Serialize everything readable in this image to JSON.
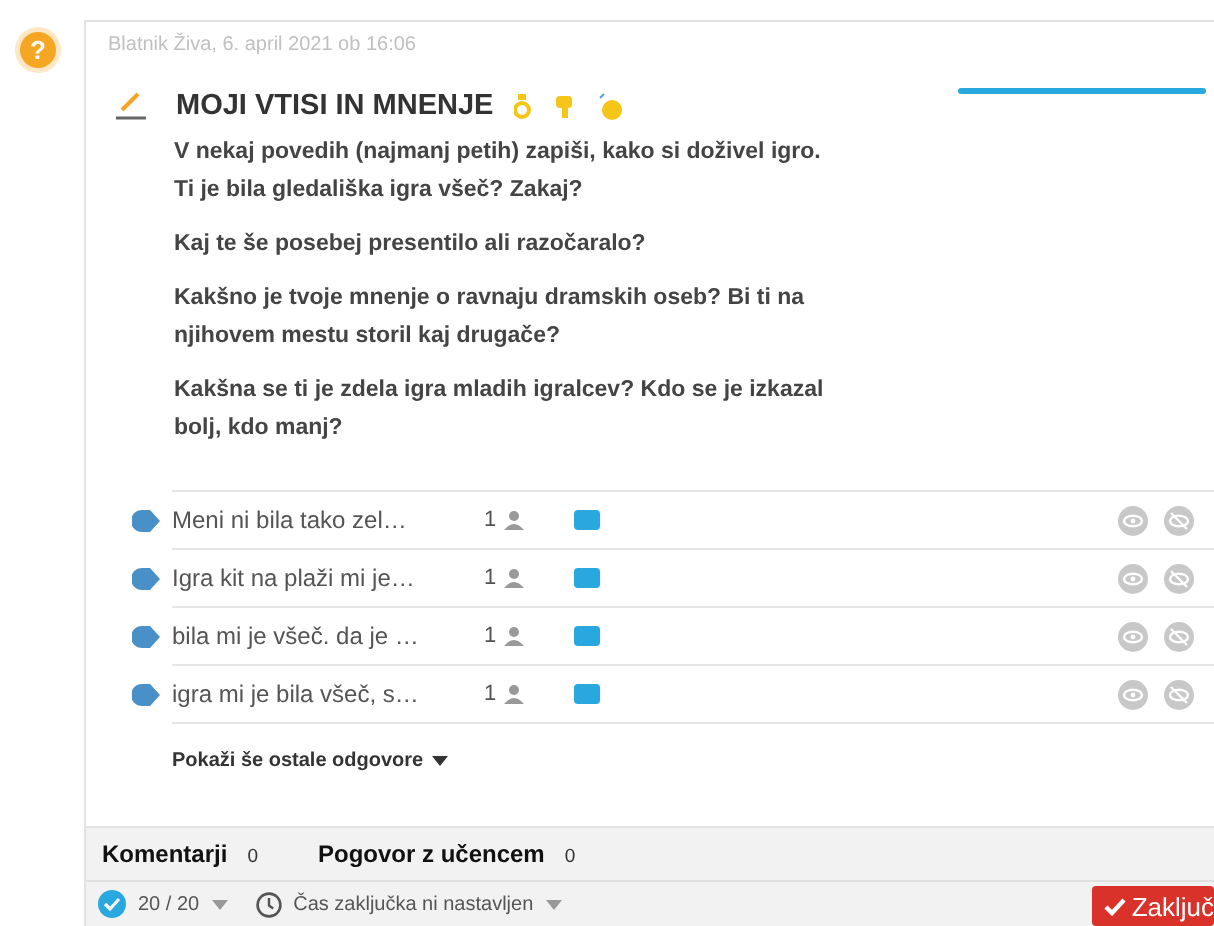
{
  "help_icon": "?",
  "post": {
    "meta": "Blatnik Živa, 6. april 2021 ob 16:06",
    "title": "MOJI VTISI IN MNENJE",
    "paragraphs": [
      "V nekaj povedih (najmanj petih) zapiši, kako si doživel igro. Ti je bila gledališka igra všeč? Zakaj?",
      "Kaj te še posebej presentilo ali razočaralo?",
      "Kakšno je tvoje mnenje o ravnaju dramskih oseb? Bi ti na njihovem mestu storil kaj drugače?",
      "Kakšna se ti je zdela igra mladih igralcev? Kdo se je izkazal bolj, kdo manj?"
    ]
  },
  "answers": [
    {
      "text": "Meni ni bila tako zel…",
      "count": "1"
    },
    {
      "text": "Igra kit na plaži mi je…",
      "count": "1"
    },
    {
      "text": "bila mi je všeč. da je …",
      "count": "1"
    },
    {
      "text": "igra mi je bila všeč, s…",
      "count": "1"
    }
  ],
  "show_more": "Pokaži še ostale odgovore",
  "tabs": [
    {
      "label": "Komentarji",
      "count": "0"
    },
    {
      "label": "Pogovor z učencem",
      "count": "0"
    }
  ],
  "footer": {
    "progress": "20 / 20",
    "deadline": "Čas zaključka ni nastavljen",
    "button": "Zaključ"
  }
}
